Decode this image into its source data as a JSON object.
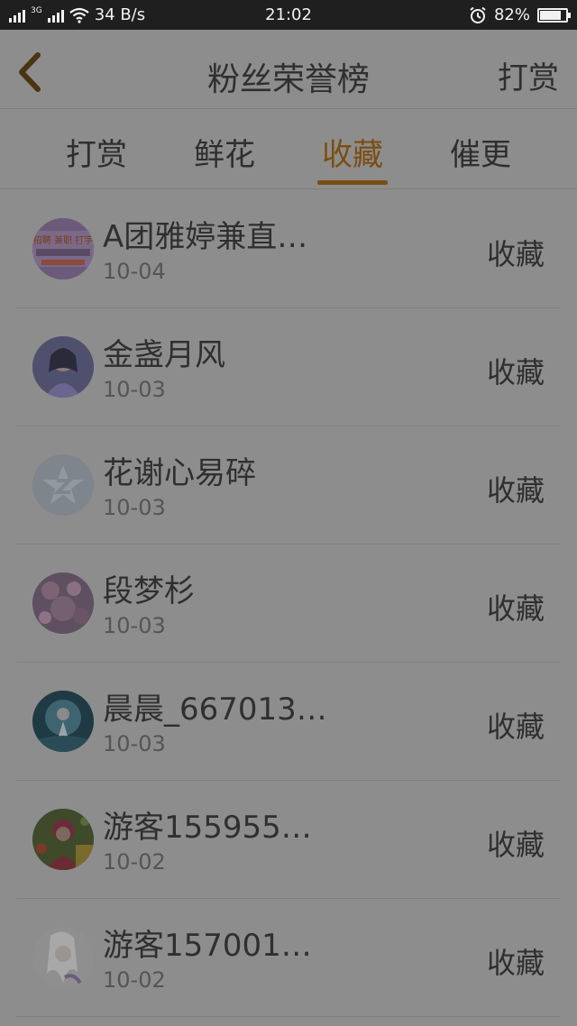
{
  "status_bar": {
    "network_label": "3G",
    "speed": "34 B/s",
    "time": "21:02",
    "battery_pct": "82%",
    "battery_level": 0.82
  },
  "header": {
    "title": "粉丝荣誉榜",
    "action_label": "打赏"
  },
  "tabs": [
    {
      "label": "打赏"
    },
    {
      "label": "鲜花"
    },
    {
      "label": "收藏",
      "active": true
    },
    {
      "label": "催更"
    }
  ],
  "colors": {
    "accent": "#7a4e12",
    "overlay_bg": "#8d8d8d",
    "text": "#2f2f2f"
  },
  "fans": [
    {
      "name": "A团雅婷兼直…",
      "date": "10-04",
      "action": "收藏",
      "avatar_icon": "badge-avatar",
      "avatar_text": "招聘 兼职 打字"
    },
    {
      "name": "金盏月风",
      "date": "10-03",
      "action": "收藏",
      "avatar_icon": "anime-girl-avatar"
    },
    {
      "name": "花谢心易碎",
      "date": "10-03",
      "action": "收藏",
      "avatar_icon": "default-star-avatar"
    },
    {
      "name": "段梦杉",
      "date": "10-03",
      "action": "收藏",
      "avatar_icon": "blossom-avatar"
    },
    {
      "name": "晨晨_667013…",
      "date": "10-03",
      "action": "收藏",
      "avatar_icon": "fantasy-avatar"
    },
    {
      "name": "游客155955…",
      "date": "10-02",
      "action": "收藏",
      "avatar_icon": "flower-girl-avatar"
    },
    {
      "name": "游客157001…",
      "date": "10-02",
      "action": "收藏",
      "avatar_icon": "sketch-avatar"
    }
  ]
}
